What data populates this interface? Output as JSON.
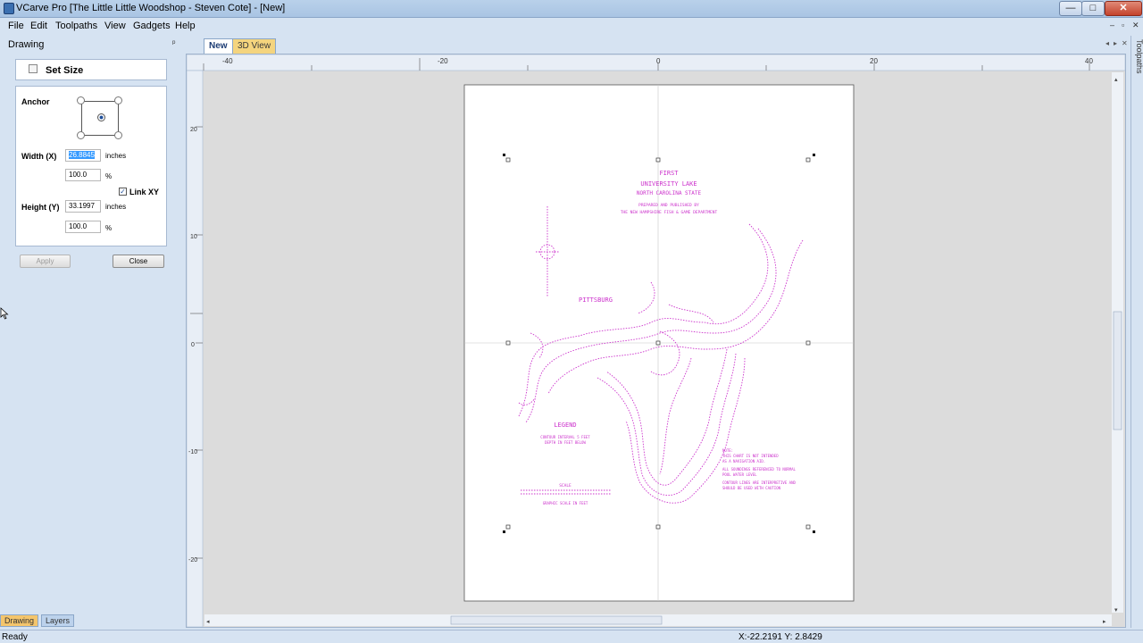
{
  "window": {
    "title": "VCarve Pro [The Little Little Woodshop - Steven Cote] - [New]",
    "minimize": "—",
    "maximize": "□",
    "close": "✕"
  },
  "menu": {
    "items": [
      "File",
      "Edit",
      "Toolpaths",
      "View",
      "Gadgets",
      "Help"
    ],
    "mdi_controls": [
      "–",
      "▫",
      "✕"
    ]
  },
  "left_panel": {
    "title": "Drawing",
    "pin": "ᵖ",
    "set_size": {
      "label": "Set Size",
      "anchor_label": "Anchor",
      "width_label": "Width (X)",
      "width_value": "26.8845",
      "width_unit": "inches",
      "width_pct": "100.0",
      "pct_unit": "%",
      "link_label": "Link XY",
      "link_checked": "✓",
      "height_label": "Height (Y)",
      "height_value": "33.1997",
      "height_unit": "inches",
      "height_pct": "100.0",
      "apply": "Apply",
      "close": "Close"
    },
    "bottom_tabs": [
      "Drawing",
      "Layers"
    ]
  },
  "doc_tabs": {
    "tabs": [
      "New",
      "3D View"
    ],
    "nav": [
      "◂",
      "▸",
      "✕"
    ]
  },
  "right_strip": {
    "label": "Toolpaths"
  },
  "ruler": {
    "top_ticks": [
      "-40",
      "-20",
      "0",
      "20",
      "40"
    ],
    "left_ticks": [
      "20",
      "10",
      "0",
      "-10",
      "-20"
    ]
  },
  "map": {
    "title_lines": [
      "FIRST",
      "UNIVERSITY LAKE",
      "NORTH CAROLINA STATE"
    ],
    "sub_lines": [
      "PREPARED AND PUBLISHED BY",
      "THE NEW HAMPSHIRE FISH & GAME DEPARTMENT"
    ],
    "place": "PITTSBURG",
    "legend_title": "LEGEND",
    "legend_lines": [
      "CONTOUR INTERVAL 5 FEET",
      "DEPTH IN FEET BELOW"
    ],
    "scale_title": "SCALE",
    "scale_note": "GRAPHIC SCALE IN FEET",
    "note_lines": [
      "NOTE:",
      "THIS CHART IS NOT INTENDED",
      "AS A NAVIGATION AID.",
      "ALL SOUNDINGS REFERENCED TO NORMAL",
      "POOL WATER LEVEL",
      "CONTOUR LINES ARE INTERPRETIVE AND",
      "SHOULD BE USED WITH CAUTION"
    ]
  },
  "status": {
    "ready": "Ready",
    "coords": "X:-22.2191 Y:  2.8429"
  },
  "colors": {
    "map_ink": "#cc33cc",
    "panel_bg": "#d6e3f2",
    "canvas_bg": "#dcdcdc"
  }
}
